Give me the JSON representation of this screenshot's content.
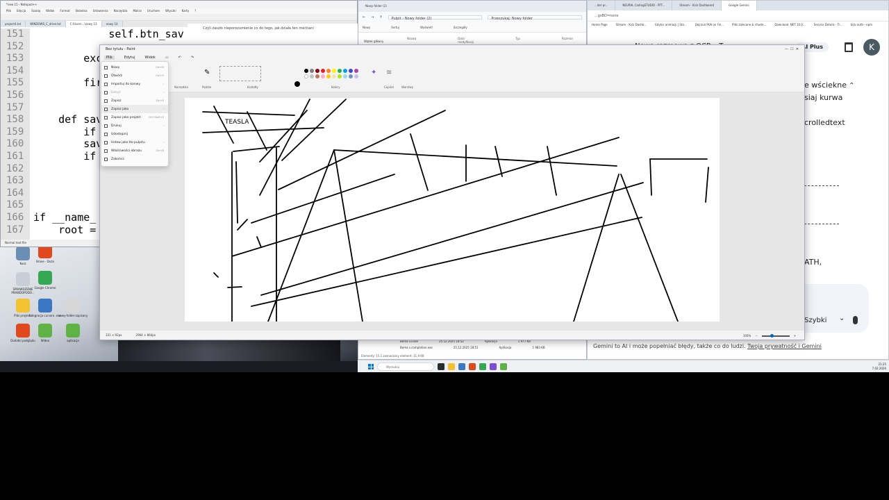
{
  "notepad": {
    "title": "*new 15 - Notepad++",
    "menu": [
      "Plik",
      "Edycja",
      "Szukaj",
      "Widok",
      "Format",
      "Składnia",
      "Ustawienia",
      "Narzędzia",
      "Makra",
      "Uruchom",
      "Wtyczki",
      "Karty",
      "?"
    ],
    "tabs": [
      "project4.txt",
      "WINDOWS_C_drive.txt",
      "C:\\Users...\\nowy 13",
      "nowy 14"
    ],
    "status": "Normal text file",
    "line_numbers": [
      "151",
      "152",
      "153",
      "154",
      "155",
      "156",
      "157",
      "158",
      "159",
      "160",
      "161",
      "162",
      "163",
      "164",
      "165",
      "166",
      "167"
    ],
    "code": [
      "            self.btn_sav",
      "",
      "        exc",
      "",
      "        fir",
      "",
      "",
      "    def sav",
      "        if",
      "        sav",
      "        if",
      "",
      "",
      "",
      "",
      "if __name_",
      "    root ="
    ],
    "side_text": "Czyli zaszło nieporozumienie co do tego, jak działa ten mechani"
  },
  "explorer": {
    "tab_title": "Nowy folder (2)",
    "path": [
      "Pulpit",
      "Nowy folder (2)"
    ],
    "search_placeholder": "Przeszukaj: Nowy folder",
    "commands": [
      "Nowy",
      "Sortuj",
      "Wyświetl",
      "Szczegóły"
    ],
    "sidebar_item": "Wątek główny",
    "columns": [
      "Nazwa",
      "Data modyfikacji",
      "Typ",
      "Rozmiar"
    ],
    "files": [
      {
        "name": "Bema v3.exe",
        "date": "25.12.2025 18:52",
        "type": "Aplikacja",
        "size": "1 977 KB"
      },
      {
        "name": "Bema v.completion.exe",
        "date": "25.12.2025 18:51",
        "type": "Aplikacja",
        "size": "1 983 KB"
      }
    ],
    "status": "Elementy: 15   1 zaznaczony element: 11,9 KB"
  },
  "chrome": {
    "tabs": [
      "...der pr...",
      "NEURAL CodingSTUDIO - PFT...",
      "Stream - Kick Dashboard",
      "Google Gemini"
    ],
    "url": "...gsBD=none",
    "bookmarks": [
      "Home Page",
      "Stream - Kick Dashb...",
      "Edytor animacji | Sto...",
      "Dojrzuń PLN on Fin...",
      "Pliki zalecane & chwile...",
      "Download .NET 10.0...",
      "Service Details - Tr...",
      "kick-auth - npm"
    ],
    "heading_partial": "Nowa rozmowa z OCR – T...",
    "plus_label": "AI Plus",
    "avatar_letter": "K",
    "body_lines": [
      "e wściekne",
      "siaj kurwa",
      "crolledtext",
      "ATH,"
    ],
    "mode_label": "Szybki",
    "footer_text": "Gemini to AI i może popełniać błędy, także co do ludzi.",
    "footer_link": "Twoja prywatność i Gemini"
  },
  "paint": {
    "title": "Bez tytułu - Paint",
    "menu": [
      "Plik",
      "Edytuj",
      "Widok"
    ],
    "ribbon_labels": [
      "Narzędzia",
      "Pędzle",
      "Kształty",
      "Kolory",
      "Copilot",
      "Warstwy"
    ],
    "canvas_text": "TEASLA",
    "status_cursor": "331 × 92px",
    "status_size": "2964 × 864px",
    "zoom": "100%",
    "zoom_fraction": 0.35,
    "colors": [
      "#000000",
      "#7f7f7f",
      "#880015",
      "#ed1c24",
      "#ff7f27",
      "#fff200",
      "#22b14c",
      "#00a2e8",
      "#3f48cc",
      "#a349a4",
      "#ffffff",
      "#c3c3c3",
      "#b97a57",
      "#ffaec9",
      "#ffc90e",
      "#efe4b0",
      "#b5e61d",
      "#99d9ea",
      "#7092be",
      "#c8bfe7"
    ]
  },
  "file_menu": [
    {
      "label": "Nowy",
      "shortcut": "Ctrl+N",
      "disabled": false
    },
    {
      "label": "Otwórz",
      "shortcut": "Ctrl+O",
      "disabled": false
    },
    {
      "label": "Importuj do kanwy",
      "shortcut": "›",
      "disabled": false
    },
    {
      "label": "Dotąd",
      "shortcut": "›",
      "disabled": true
    },
    {
      "label": "Zapisz",
      "shortcut": "Ctrl+S",
      "disabled": false
    },
    {
      "label": "Zapisz jako",
      "shortcut": "›",
      "disabled": false
    },
    {
      "label": "Zapisz jako projekt",
      "shortcut": "Ctrl+Shift+S",
      "disabled": false
    },
    {
      "label": "Drukuj",
      "shortcut": "›",
      "disabled": false
    },
    {
      "label": "Udostępnij",
      "shortcut": "",
      "disabled": false
    },
    {
      "label": "Ustaw jako tło pulpitu",
      "shortcut": "›",
      "disabled": false
    },
    {
      "label": "Właściwości obrazu",
      "shortcut": "Ctrl+E",
      "disabled": false
    },
    {
      "label": "Zakończ",
      "shortcut": "",
      "disabled": false
    }
  ],
  "desktop_icons": [
    {
      "label": "Kosz",
      "color": "#6b8fb4"
    },
    {
      "label": "Brave - Duża",
      "color": "#e0481e"
    },
    {
      "label": "SPRAWDZENIE PRAWDOPODO...",
      "color": "#c9ced6"
    },
    {
      "label": "Google Chrome",
      "color": "#34a853"
    },
    {
      "label": "Pliki projektu",
      "color": "#f2c230"
    },
    {
      "label": "Integracja cursora .exe",
      "color": "#3a78c3"
    },
    {
      "label": "nowy-folder-zapisany",
      "color": "#d7d7d7"
    },
    {
      "label": "Dodatki podglądu",
      "color": "#e0481e"
    },
    {
      "label": "Wideo",
      "color": "#5fb346"
    },
    {
      "label": "aplikacja",
      "color": "#5fb346"
    }
  ],
  "taskbar": {
    "search_placeholder": "Wyszukaj",
    "time": "21:25",
    "date": "7.02.2026"
  }
}
